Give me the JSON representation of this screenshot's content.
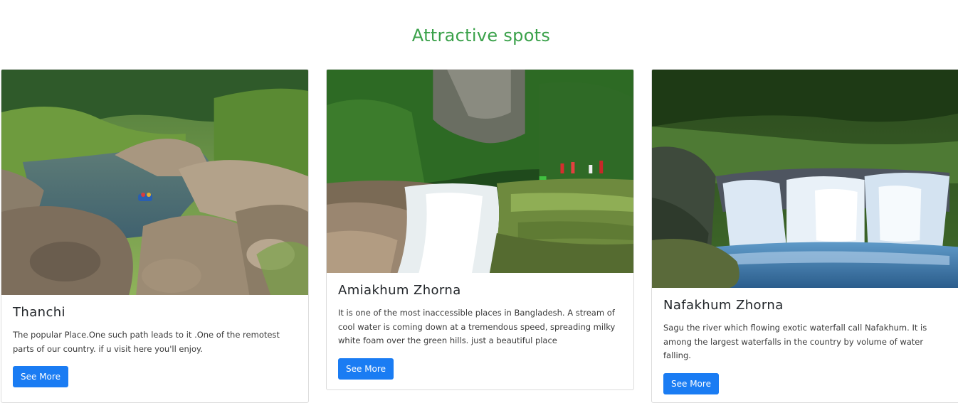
{
  "section": {
    "title": "Attractive spots"
  },
  "cards": [
    {
      "title": "Thanchi",
      "description": "The popular Place.One such path leads to it .One of the remotest parts of our country. if u visit here you'll enjoy.",
      "button_label": "See More"
    },
    {
      "title": "Amiakhum Zhorna",
      "description": "It is one of the most inaccessible places in Bangladesh. A stream of cool water is coming down at a tremendous speed, spreading milky white foam over the green hills. just a beautiful place",
      "button_label": "See More"
    },
    {
      "title": "Nafakhum Zhorna",
      "description": "Sagu the river which flowing exotic waterfall call Nafakhum. It is among the largest waterfalls in the country by volume of water falling.",
      "button_label": "See More"
    }
  ],
  "colors": {
    "heading": "#3aa14a",
    "button": "#1a7cf3"
  }
}
